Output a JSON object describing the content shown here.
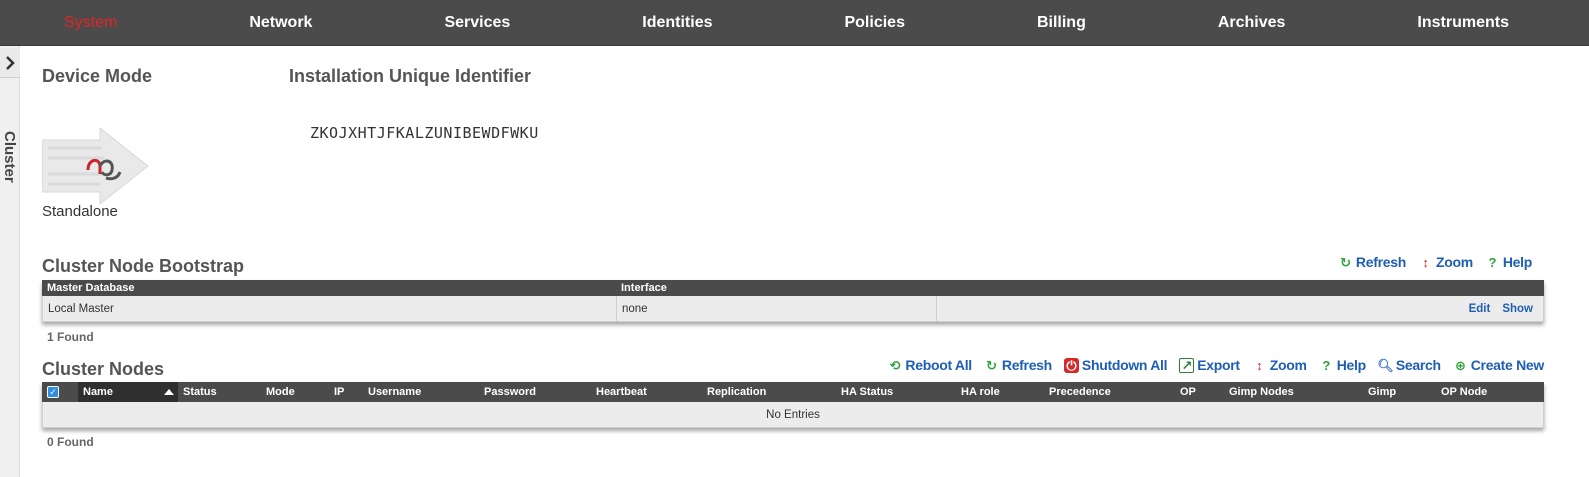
{
  "nav": {
    "items": [
      {
        "label": "System",
        "active": true
      },
      {
        "label": "Network"
      },
      {
        "label": "Services"
      },
      {
        "label": "Identities"
      },
      {
        "label": "Policies"
      },
      {
        "label": "Billing"
      },
      {
        "label": "Archives"
      },
      {
        "label": "Instruments"
      }
    ]
  },
  "sidebar": {
    "toggle_icon": "chevron-right-icon",
    "label": "Cluster"
  },
  "device": {
    "title": "Device Mode",
    "mode": "Standalone",
    "uid_title": "Installation Unique Identifier",
    "uid_value": "ZKOJXHTJFKALZUNIBEWDFWKU"
  },
  "bootstrap": {
    "title": "Cluster Node Bootstrap",
    "toolbar": {
      "refresh": "Refresh",
      "zoom": "Zoom",
      "help": "Help"
    },
    "columns": [
      "Master Database",
      "Interface"
    ],
    "rows": [
      {
        "master_database": "Local Master",
        "interface": "none",
        "edit": "Edit",
        "show": "Show"
      }
    ],
    "found": "1 Found"
  },
  "cluster": {
    "title": "Cluster Nodes",
    "toolbar": {
      "reboot_all": "Reboot All",
      "refresh": "Refresh",
      "shutdown_all": "Shutdown All",
      "export": "Export",
      "zoom": "Zoom",
      "help": "Help",
      "search": "Search",
      "create_new": "Create New"
    },
    "columns": [
      "Name",
      "Status",
      "Mode",
      "IP",
      "Username",
      "Password",
      "Heartbeat",
      "Replication",
      "HA Status",
      "HA role",
      "Precedence",
      "OP",
      "Gimp Nodes",
      "Gimp",
      "OP Node"
    ],
    "empty": "No Entries",
    "found": "0 Found"
  },
  "colors": {
    "nav_bg": "#4b4b4b",
    "active": "#e32424",
    "link": "#1f5fb3",
    "icon_green": "#2fa23a"
  }
}
